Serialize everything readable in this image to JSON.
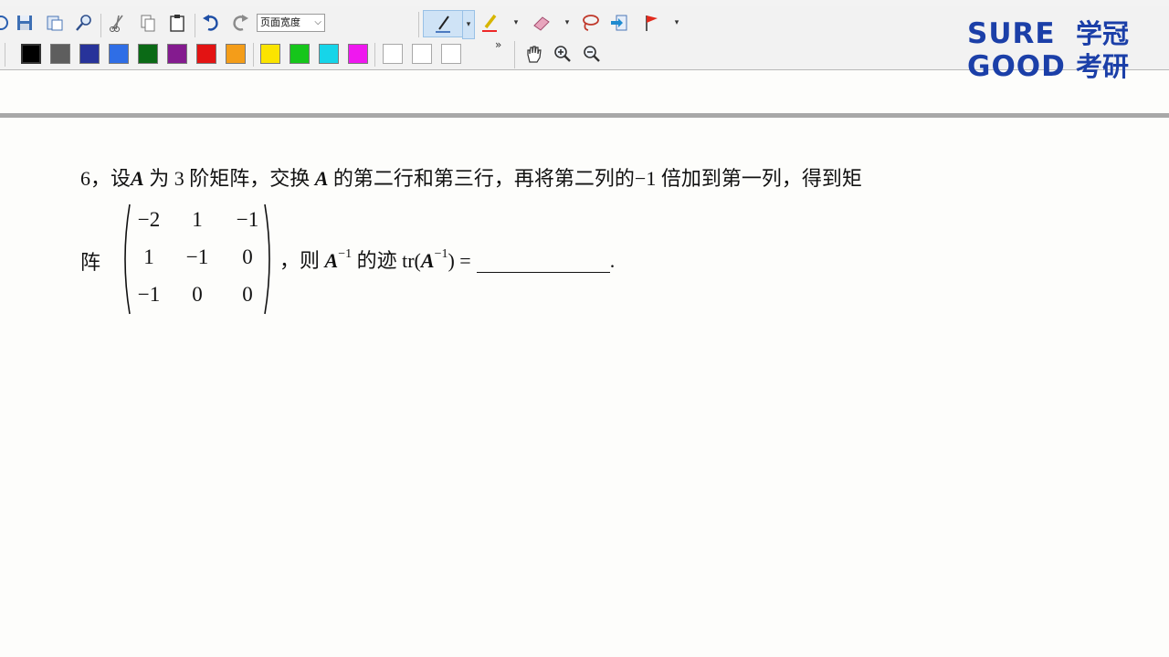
{
  "toolbar": {
    "zoom_value": "页面宽度",
    "colors": {
      "black": "#000000",
      "gray": "#5e5e5e",
      "navy": "#27339a",
      "blue": "#2f6ee6",
      "green": "#0b6a16",
      "purple": "#841b8f",
      "red": "#e31313",
      "orange": "#f49d19",
      "yellow": "#fbe400",
      "lime": "#16c61b",
      "cyan": "#16d5e9",
      "magenta": "#ef18ef"
    },
    "overflow_label": "»"
  },
  "logo": {
    "line1_en": "SURE",
    "line1_zh": "学冠",
    "line2_en": "GOOD",
    "line2_zh": "考研"
  },
  "question": {
    "number": "6",
    "text_part1": "，设",
    "var_a": "A",
    "text_part2": " 为 3 阶矩阵，交换 ",
    "text_part3": " 的第二行和第三行，再将第二列的",
    "coef": "−1",
    "text_part4": " 倍加到第一列，得到矩",
    "row_label": "阵",
    "matrix": [
      [
        "−2",
        "1",
        "−1"
      ],
      [
        "1",
        "−1",
        "0"
      ],
      [
        "−1",
        "0",
        "0"
      ]
    ],
    "tail_prefix": "，则 ",
    "inv_sup": "−1",
    "tail_mid": " 的迹 tr(",
    "tail_close": ") =",
    "tail_end": "."
  }
}
